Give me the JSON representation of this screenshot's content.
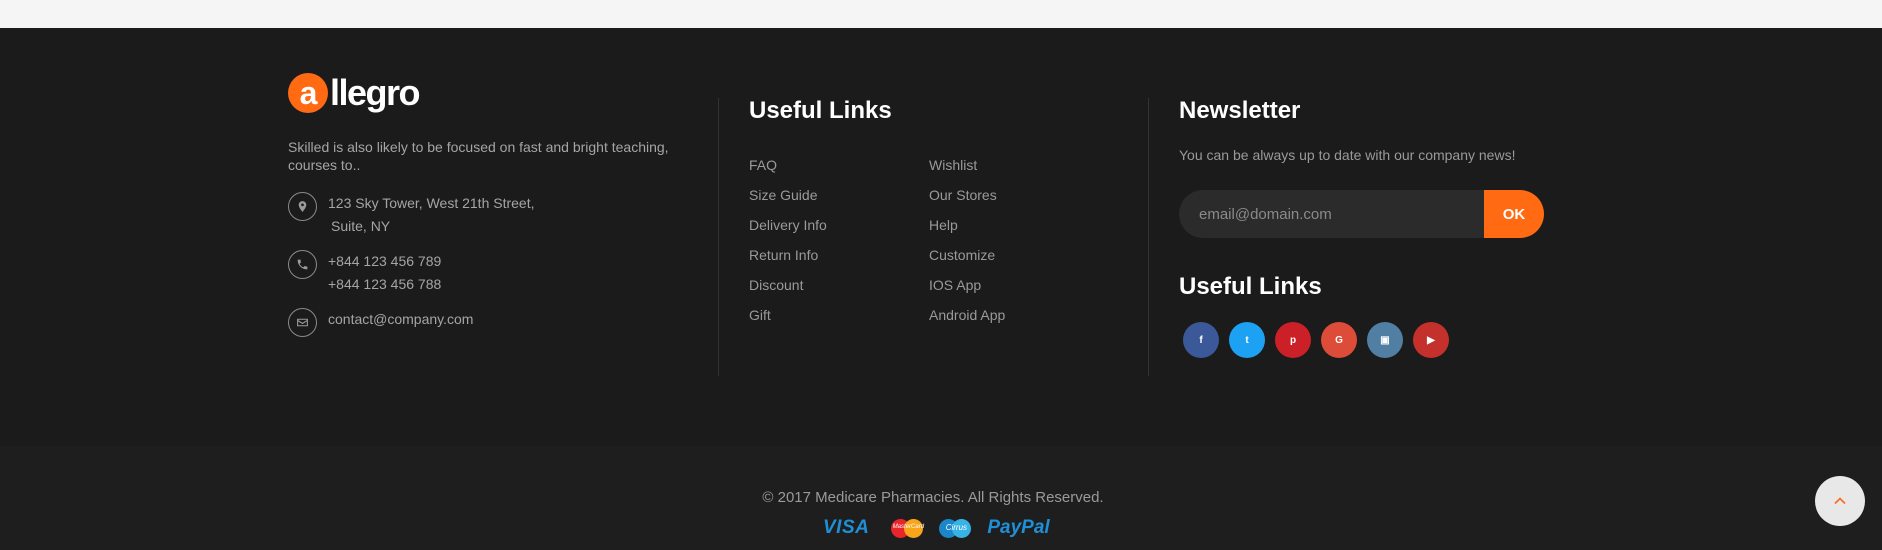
{
  "brand": {
    "logo_letter": "a",
    "logo_text": "llegro",
    "accent": "#ff6a13"
  },
  "about": {
    "text": "Skilled is also likely to be focused on fast and bright teaching, courses to.."
  },
  "contact": {
    "address_line1": "123 Sky Tower, West 21th Street,",
    "address_line2": "Suite, NY",
    "phone1": "+844 123 456 789",
    "phone2": "+844 123 456 788",
    "email": "contact@company.com"
  },
  "useful_links": {
    "heading": "Useful Links",
    "col1": [
      "FAQ",
      "Size Guide",
      "Delivery Info",
      "Return Info",
      "Discount",
      "Gift"
    ],
    "col2": [
      "Wishlist",
      "Our Stores",
      "Help",
      "Customize",
      "IOS App",
      "Android App"
    ]
  },
  "newsletter": {
    "heading": "Newsletter",
    "text": "You can be always up to date with our company news!",
    "placeholder": "email@domain.com",
    "button_label": "OK"
  },
  "social": {
    "heading": "Useful Links",
    "items": [
      {
        "icon": "facebook-icon",
        "glyph": "f",
        "color": "#3b5998"
      },
      {
        "icon": "twitter-icon",
        "glyph": "t",
        "color": "#1da1f2"
      },
      {
        "icon": "pinterest-icon",
        "glyph": "p",
        "color": "#cb2027"
      },
      {
        "icon": "google-icon",
        "glyph": "G",
        "color": "#dd4b39"
      },
      {
        "icon": "flickr-icon",
        "glyph": "▣",
        "color": "#517fa4"
      },
      {
        "icon": "youtube-icon",
        "glyph": "▶",
        "color": "#c4302b"
      }
    ]
  },
  "bottom": {
    "copyright": "© 2017 Medicare Pharmacies. All Rights Reserved.",
    "payments": {
      "visa": "VISA",
      "mastercard": "MasterCard",
      "cirrus": "Cirrus",
      "paypal": "PayPal"
    }
  }
}
